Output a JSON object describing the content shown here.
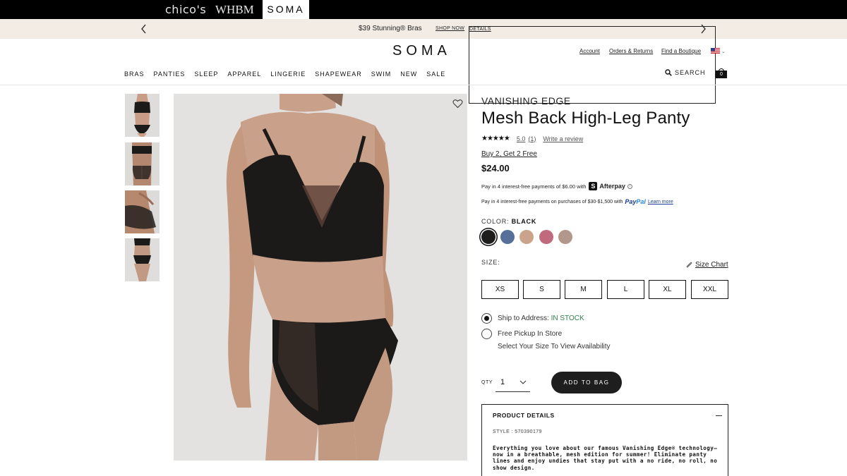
{
  "brands": {
    "chicos": "chico's",
    "whbm": "WHBM",
    "soma": "SOMA"
  },
  "promo": {
    "message": "$39 Stunning® Bras",
    "shop_now": "SHOP NOW",
    "details": "DETAILS"
  },
  "header": {
    "logo": "SOMA",
    "account": "Account",
    "orders": "Orders & Returns",
    "find_boutique": "Find a Boutique",
    "search_label": "SEARCH",
    "bag_count": "0"
  },
  "nav": {
    "items": [
      "BRAS",
      "PANTIES",
      "SLEEP",
      "APPAREL",
      "LINGERIE",
      "SHAPEWEAR",
      "SWIM",
      "NEW",
      "SALE"
    ]
  },
  "product": {
    "brand_line": "VANISHING EDGE",
    "title": "Mesh Back High-Leg Panty",
    "stars": "★★★★★",
    "rating": "5.0",
    "review_count": "(1)",
    "write_review": "Write a review",
    "promotion": "Buy 2, Get 2 Free",
    "price": "$24.00",
    "afterpay_text": "Pay in 4 interest-free payments of $6.00 with",
    "afterpay_icon": "S",
    "afterpay_name": "Afterpay",
    "afterpay_info": "i",
    "paypal_text": "Pay in 4 interest-free payments on purchases of $30-$1,500 with",
    "paypal_pay": "Pay",
    "paypal_pal": "Pal",
    "paypal_learn": "Learn more",
    "color_label": "COLOR:",
    "color_value": "BLACK",
    "swatches": [
      {
        "name": "black",
        "color": "#1f1d1c"
      },
      {
        "name": "slate-blue",
        "color": "#56709a"
      },
      {
        "name": "nude",
        "color": "#c9a48a"
      },
      {
        "name": "rose",
        "color": "#c06a7e"
      },
      {
        "name": "mocha",
        "color": "#b2978a"
      }
    ],
    "size_label": "SIZE:",
    "size_chart": "Size Chart",
    "sizes": [
      "XS",
      "S",
      "M",
      "L",
      "XL",
      "XXL"
    ],
    "ship_label": "Ship to Address:",
    "ship_status": "IN STOCK",
    "pickup_label": "Free Pickup In Store",
    "pickup_sub": "Select Your Size To View Availability",
    "qty_label": "QTY",
    "qty_value": "1",
    "add_to_bag": "ADD TO BAG",
    "details_head": "PRODUCT DETAILS",
    "style": "STYLE : 570390179",
    "description": "Everything you love about our famous Vanishing Edge® technology—now in a breathable, mesh edition for summer! Eliminate panty lines and enjoy undies that stay put with a no ride, no roll, no show design."
  }
}
